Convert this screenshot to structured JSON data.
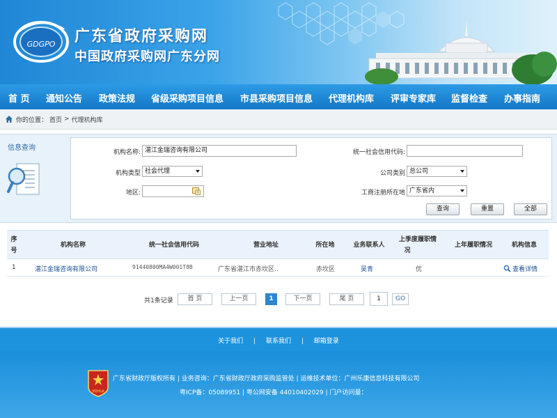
{
  "header": {
    "title": "广东省政府采购网",
    "subtitle": "中国政府采购网广东分网",
    "logo_text": "GDGPO"
  },
  "nav": {
    "items": [
      "首 页",
      "通知公告",
      "政策法规",
      "省级采购项目信息",
      "市县采购项目信息",
      "代理机构库",
      "评审专家库",
      "监督检查",
      "办事指南"
    ]
  },
  "breadcrumb": {
    "prefix": "你的位置：",
    "home": "首页",
    "sep": ">",
    "current": "代理机构库"
  },
  "query": {
    "panel_title": "信息查询",
    "org_name_label": "机构名称:",
    "org_name_value": "湛江金瑞咨询有限公司",
    "credit_code_label": "统一社会信用代码:",
    "credit_code_value": "",
    "org_type_label": "机构类型",
    "org_type_value": "社会代理",
    "company_type_label": "公司类别",
    "company_type_value": "总公司",
    "region_label": "地区:",
    "region_value": "",
    "reg_place_label": "工商注册所在地",
    "reg_place_value": "广东省内",
    "btn_query": "查询",
    "btn_reset": "重置",
    "btn_all": "全部"
  },
  "table": {
    "headers": {
      "index_a": "序",
      "index_b": "号",
      "name": "机构名称",
      "code": "统一社会信用代码",
      "address": "营业地址",
      "location": "所在地",
      "contact": "业务联系人",
      "last_q_a": "上季度履职情",
      "last_q_b": "况",
      "last_year": "上年履职情况",
      "info": "机构信息"
    },
    "rows": [
      {
        "index": "1",
        "name": "湛江金瑞咨询有限公司",
        "code": "91440800MA4W001T8B",
        "address": "广东省湛江市赤坎区..",
        "location": "赤坎区",
        "contact": "吴青",
        "last_q": "优",
        "last_year": "",
        "info": "查看详情"
      }
    ]
  },
  "pager": {
    "total": "共1条记录",
    "first": "首 页",
    "prev": "上一页",
    "current": "1",
    "next": "下一页",
    "last": "尾 页",
    "jump_value": "1",
    "go": "GO"
  },
  "footer": {
    "links": [
      "关于我们",
      "联系我们",
      "邮箱登录"
    ],
    "sep": "|",
    "line1": "广东省财政厅版权所有  |  业务咨询：广东省财政厅政府采购监管处  |  运维技术单位：广州乐康信息科技有限公司",
    "line2": "粤ICP备：05089951  |  粤公网安备 44010402029  |  门户访问量：",
    "emblem_label": "党政机关"
  },
  "colors": {
    "primary": "#1478c6",
    "nav_top": "#2d9be6",
    "panel_bg": "#e7f2fa",
    "footer": "#1d93dd"
  }
}
